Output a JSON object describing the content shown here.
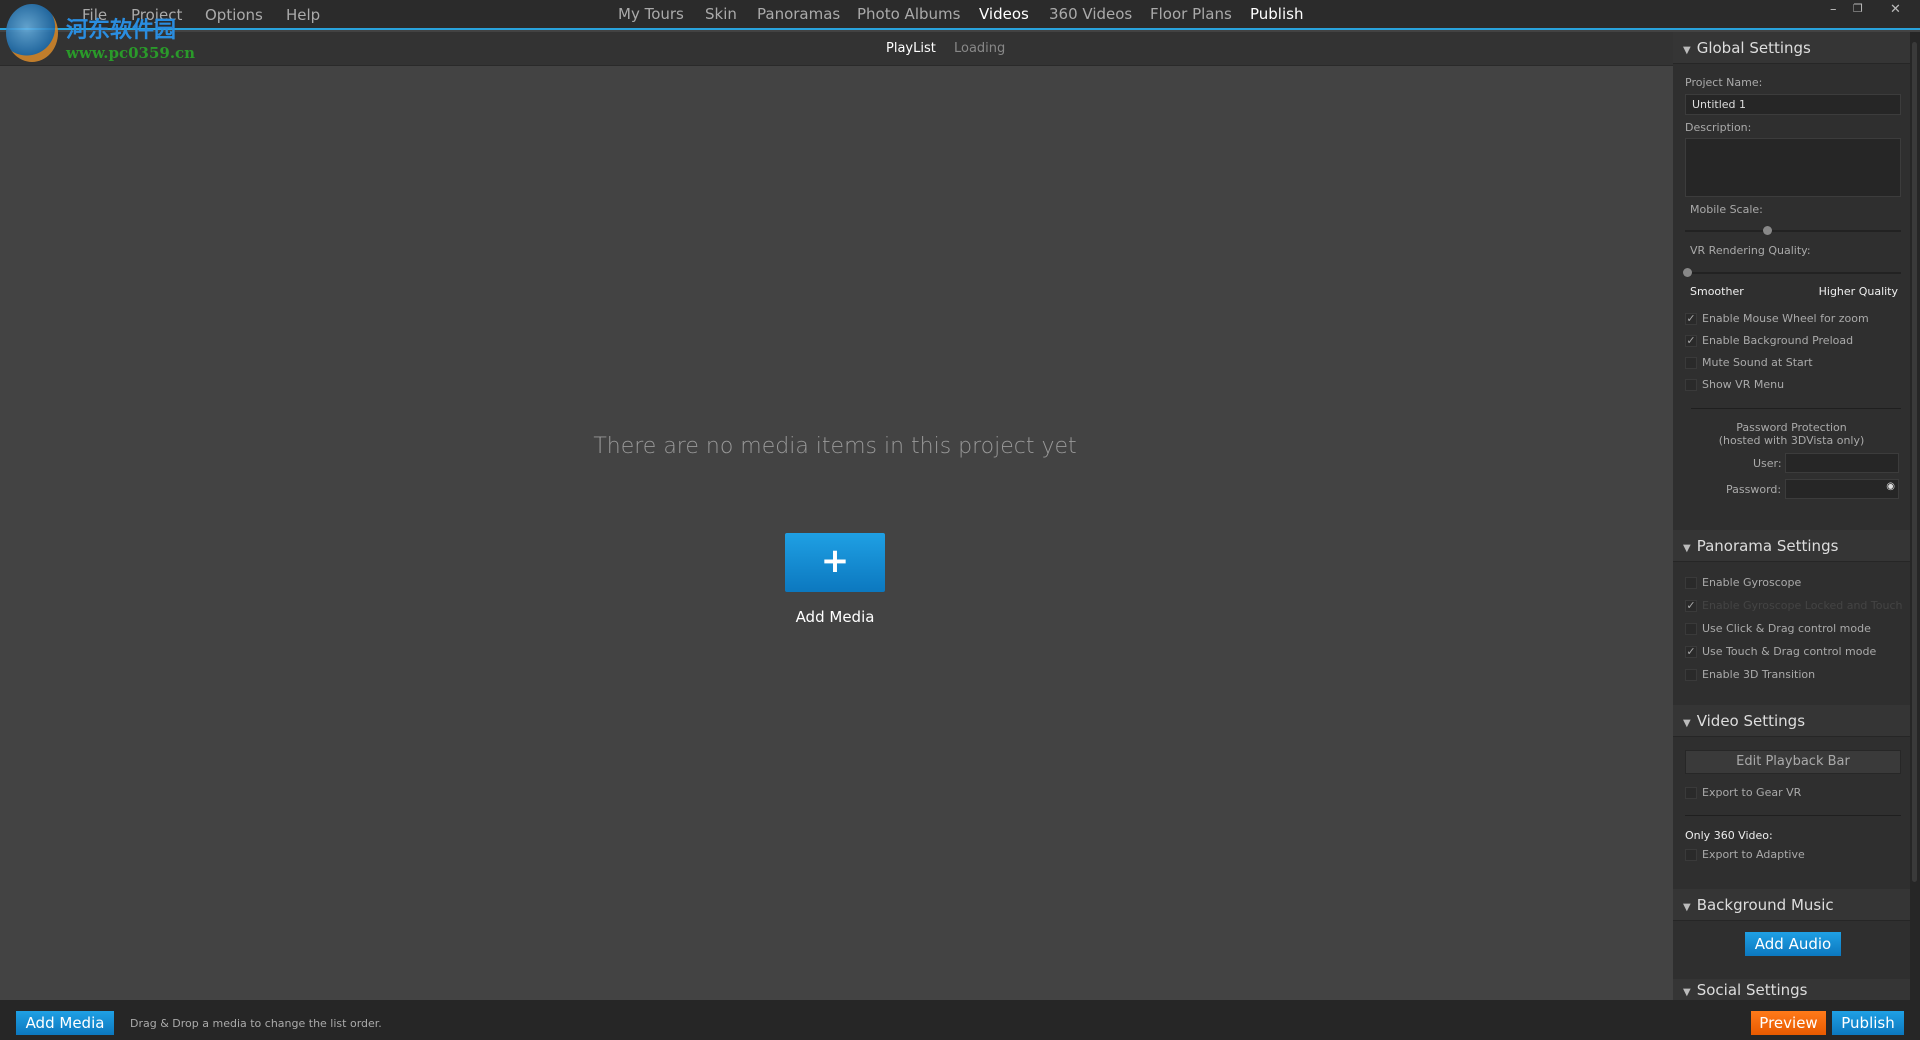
{
  "menu": [
    "File",
    "Project",
    "Options",
    "Help"
  ],
  "nav": [
    "My Tours",
    "Skin",
    "Panoramas",
    "Photo Albums",
    "Videos",
    "360 Videos",
    "Floor Plans",
    "Publish"
  ],
  "nav_active": [
    "Videos",
    "Publish"
  ],
  "subtabs": [
    "PlayList",
    "Loading"
  ],
  "main": {
    "empty_message": "There are no media items in this project yet",
    "add_icon": "+",
    "add_label": "Add Media"
  },
  "watermark": {
    "text": "河东软件园",
    "url": "www.pc0359.cn"
  },
  "window": {
    "minimize": "–",
    "restore": "❐",
    "close": "✕"
  },
  "global": {
    "title": "Global Settings",
    "project_name_label": "Project Name:",
    "project_name": "Untitled 1",
    "description_label": "Description:",
    "mobile_scale_label": "Mobile Scale:",
    "mobile_scale": 0.38,
    "vr_quality_label": "VR Rendering Quality:",
    "vr_quality": 0,
    "smoother": "Smoother",
    "higher": "Higher Quality",
    "checks": [
      {
        "label": "Enable Mouse Wheel for zoom",
        "checked": true
      },
      {
        "label": "Enable Background Preload",
        "checked": true
      },
      {
        "label": "Mute Sound at Start",
        "checked": false
      },
      {
        "label": "Show VR Menu",
        "checked": false
      }
    ],
    "pw_title": "Password Protection",
    "pw_sub": "(hosted with 3DVista only)",
    "user_label": "User:",
    "password_label": "Password:"
  },
  "panorama": {
    "title": "Panorama Settings",
    "checks": [
      {
        "label": "Enable Gyroscope",
        "checked": false
      },
      {
        "label": "Enable Gyroscope Locked and Touch",
        "checked": true,
        "disabled": true
      },
      {
        "label": "Use Click & Drag control mode",
        "checked": false
      },
      {
        "label": "Use Touch & Drag control mode",
        "checked": true
      },
      {
        "label": "Enable 3D Transition",
        "checked": false
      }
    ]
  },
  "video": {
    "title": "Video Settings",
    "edit_bar": "Edit Playback Bar",
    "gear_vr": "Export to Gear VR",
    "only360": "Only 360 Video:",
    "adaptive": "Export to Adaptive"
  },
  "music": {
    "title": "Background Music",
    "add_audio": "Add Audio"
  },
  "social": {
    "title": "Social Settings"
  },
  "bottom": {
    "add_media": "Add Media",
    "hint": "Drag & Drop a media to change the list order.",
    "preview": "Preview",
    "publish": "Publish"
  }
}
